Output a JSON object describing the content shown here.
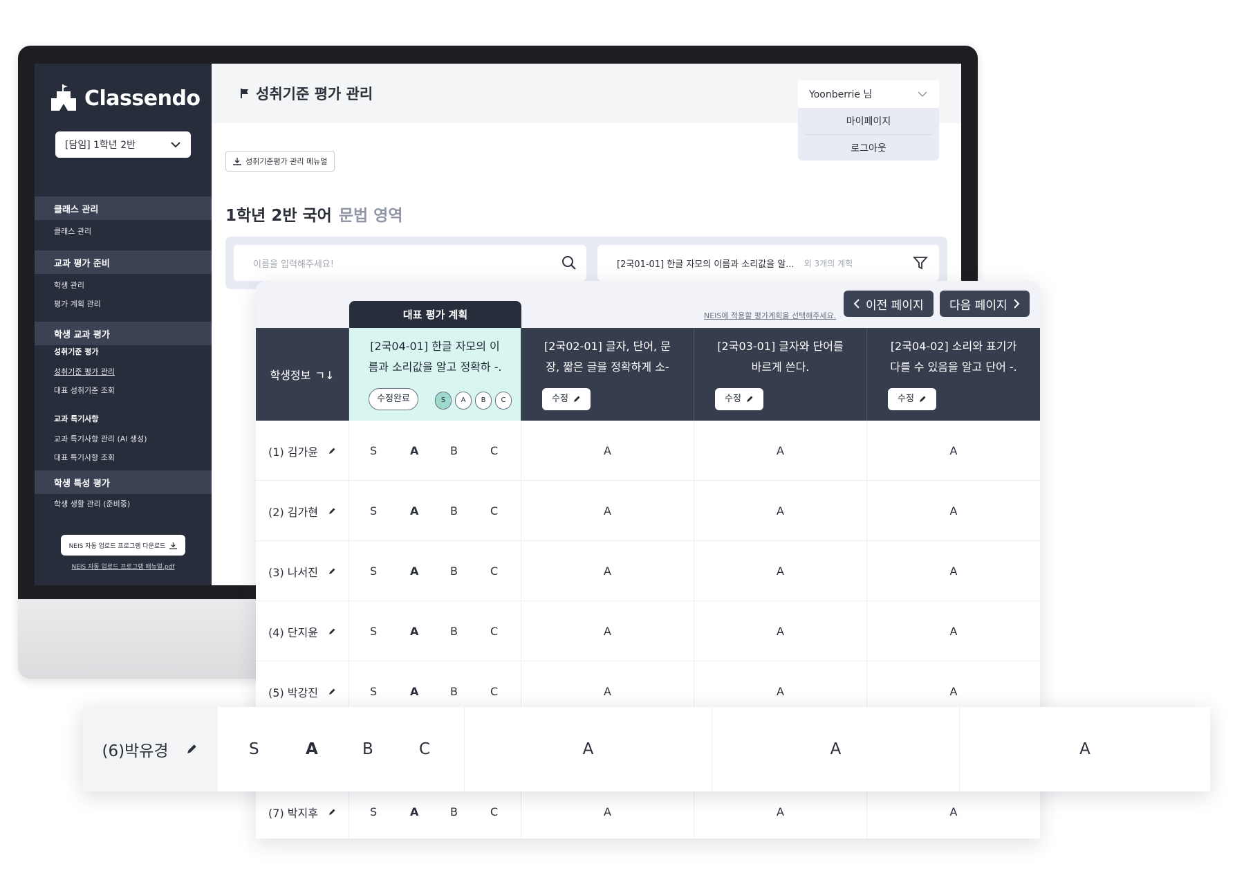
{
  "app": {
    "logo_text": "Classendo",
    "class_select": "[담임] 1학년 2반"
  },
  "sidebar": {
    "sections": [
      {
        "title": "클래스 관리",
        "items": [
          "클래스 관리"
        ]
      },
      {
        "title": "교과 평가 준비",
        "items": [
          "학생 관리",
          "평가 계획 관리"
        ]
      },
      {
        "title": "학생 교과 평가",
        "groups": [
          {
            "title": "성취기준 평가",
            "items": [
              "성취기준 평가 관리",
              "대표 성취기준 조회"
            ]
          },
          {
            "title": "교과 특기사항",
            "items": [
              "교과 특기사항 관리 (AI 생성)",
              "대표 특기사항 조회"
            ]
          }
        ]
      },
      {
        "title": "학생 특성 평가",
        "items": [
          "학생 생활 관리 (준비중)"
        ]
      }
    ],
    "neis_button": "NEIS 자동 업로드 프로그램 다운로드",
    "neis_manual_link": "NEIS 자동 업로드 프로그램 매뉴얼.pdf"
  },
  "header": {
    "page_title": "성취기준 평가 관리",
    "user_name": "Yoonberrie 님",
    "user_menu": [
      "마이페이지",
      "로그아웃"
    ],
    "manual_button": "성취기준평가 관리 메뉴얼"
  },
  "subject": {
    "title": "1학년 2반 국어",
    "area": "문법 영역"
  },
  "search": {
    "placeholder": "이름을 입력해주세요!",
    "plan_filter": "[2국01-01] 한글 자모의 이름과 소리값을 알...",
    "plan_more": "외 3개의 계획"
  },
  "table": {
    "rep_label": "대표 평가 계획",
    "neis_hint": "NEIS에 적용할 평가계획을 선택해주세요.",
    "prev_page": "이전 페이지",
    "next_page": "다음 페이지",
    "student_header": "학생정보",
    "sort_icon_label": "ㄱ↓",
    "plans": [
      {
        "line1": "[2국04-01] 한글 자모의 이",
        "line2": "름과 소리값을 알고 정확하 -.",
        "representative": true
      },
      {
        "line1": "[2국02-01] 글자, 단어, 문",
        "line2": "장, 짧은 글을 정확하게 소-",
        "representative": false
      },
      {
        "line1": "[2국03-01] 글자와 단어를",
        "line2": "바르게 쓴다.",
        "representative": false
      },
      {
        "line1": "[2국04-02] 소리와 표기가",
        "line2": "다를 수 있음을 알고 단어 -.",
        "representative": false
      }
    ],
    "done_label": "수정완료",
    "edit_label": "수정",
    "grade_options": [
      "S",
      "A",
      "B",
      "C"
    ],
    "selected_grade_chip": "S",
    "rows": [
      {
        "name": "(1) 김가윤",
        "rep": "A",
        "p2": "A",
        "p3": "A",
        "p4": "A"
      },
      {
        "name": "(2) 김가현",
        "rep": "A",
        "p2": "A",
        "p3": "A",
        "p4": "A"
      },
      {
        "name": "(3) 나서진",
        "rep": "A",
        "p2": "A",
        "p3": "A",
        "p4": "A"
      },
      {
        "name": "(4) 단지윤",
        "rep": "A",
        "p2": "A",
        "p3": "A",
        "p4": "A"
      },
      {
        "name": "(5) 박강진",
        "rep": "A",
        "p2": "A",
        "p3": "A",
        "p4": "A"
      },
      {
        "name": "(7) 박지후",
        "rep": "A",
        "p2": "A",
        "p3": "A",
        "p4": "A"
      }
    ],
    "highlight_row": {
      "name": "(6)박유경",
      "rep": "A",
      "p2": "A",
      "p3": "A",
      "p4": "A"
    }
  },
  "colors": {
    "sidebar_bg": "#272d3a",
    "header_dark": "#363d4d",
    "rep_highlight": "#d8f5ef",
    "selected_chip": "#9fd9cd"
  }
}
